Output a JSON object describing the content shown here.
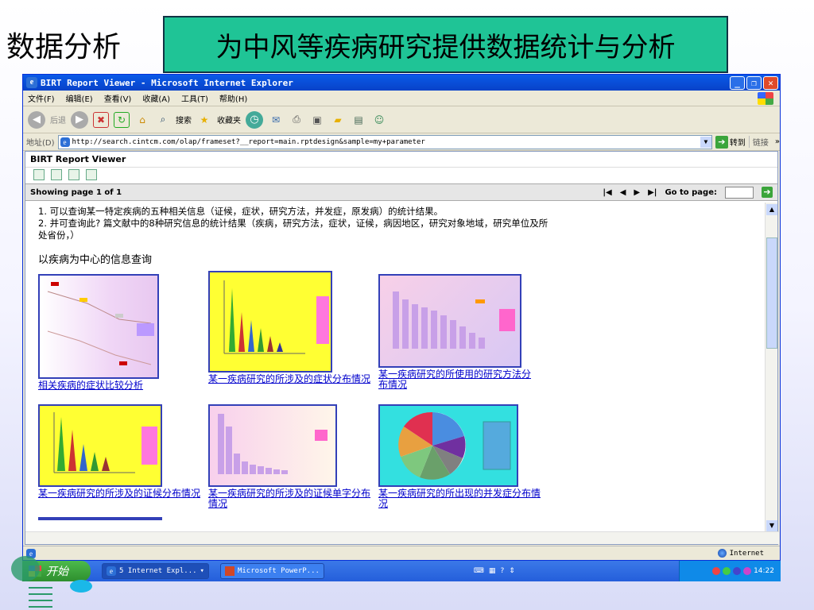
{
  "slide": {
    "title": "数据分析",
    "banner": "为中风等疾病研究提供数据统计与分析"
  },
  "window": {
    "title": "BIRT Report Viewer - Microsoft Internet Explorer",
    "menu": [
      "文件(F)",
      "编辑(E)",
      "查看(V)",
      "收藏(A)",
      "工具(T)",
      "帮助(H)"
    ],
    "toolbar": {
      "back": "后退",
      "search": "搜索",
      "favorites": "收藏夹"
    },
    "address": {
      "label": "地址(D)",
      "url": "http://search.cintcm.com/olap/frameset?__report=main.rptdesign&sample=my+parameter",
      "go": "转到",
      "links": "链接"
    },
    "status_zone": "Internet"
  },
  "viewer": {
    "header": "BIRT Report Viewer",
    "page_info": "Showing page  1  of  1",
    "goto_label": "Go to page:"
  },
  "report": {
    "line1": "1.   可以查询某一特定疾病的五种相关信息（证候，症状，研究方法，并发症，原发病）的统计结果。",
    "line2": "2.   并可查询此? 篇文献中的8种研究信息的统计结果（疾病，研究方法，症状，证候，病因地区，研究对象地域，研究单位及所",
    "line3": "处省份，）",
    "section_title": "以疾病为中心的信息查询",
    "thumbnails": [
      {
        "label": "相关疾病的症状比较分析"
      },
      {
        "label": "某一疾病研究的所涉及的症状分布情况"
      },
      {
        "label": "某一疾病研究的所使用的研究方法分布情况"
      },
      {
        "label": "某一疾病研究的所涉及的证候分布情况"
      },
      {
        "label": "某一疾病研究的所涉及的证候单字分布情况"
      },
      {
        "label": "某一疾病研究的所出现的并发症分布情况"
      }
    ]
  },
  "taskbar": {
    "start": "开始",
    "tasks": [
      "5 Internet Expl...",
      "Microsoft PowerP..."
    ],
    "clock": "14:22"
  }
}
